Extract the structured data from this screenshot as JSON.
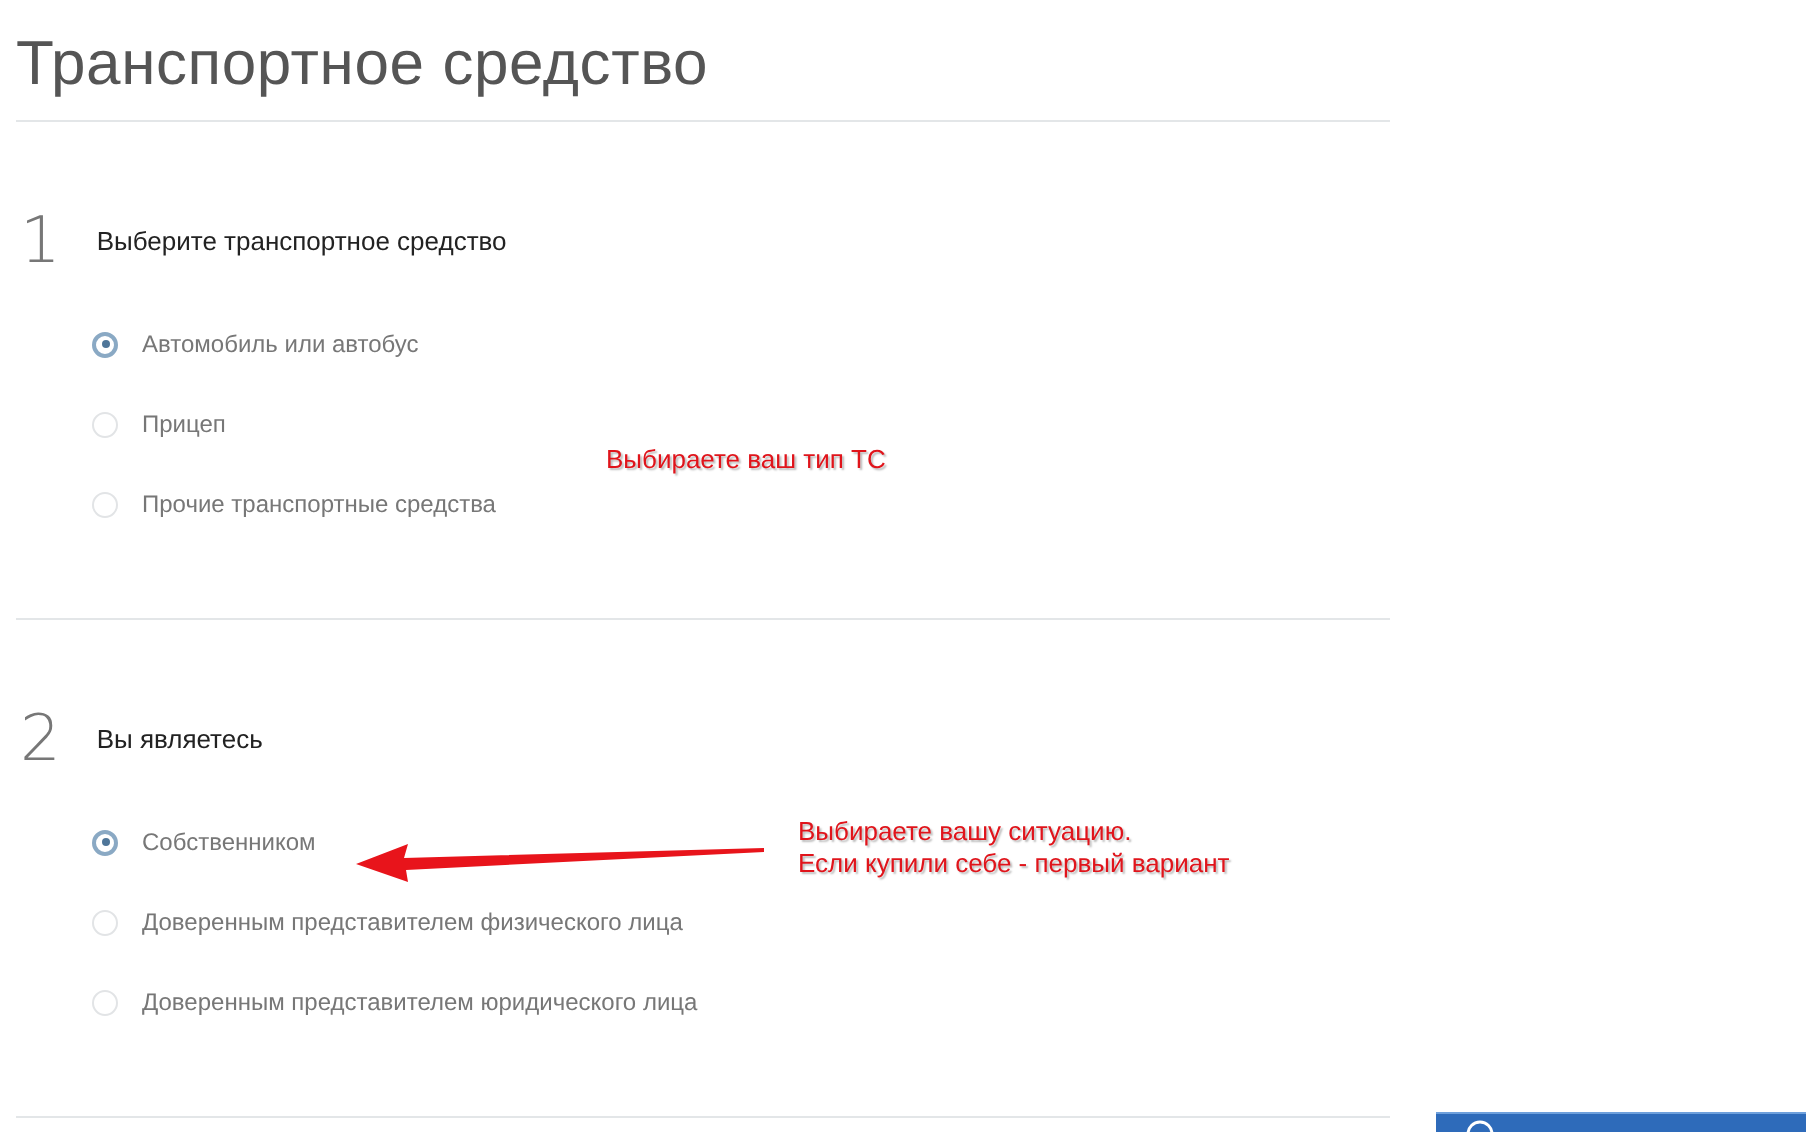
{
  "title": "Транспортное средство",
  "sections": [
    {
      "number": "1",
      "heading": "Выберите транспортное средство",
      "options": [
        {
          "label": "Автомобиль или автобус",
          "selected": true
        },
        {
          "label": "Прицеп",
          "selected": false
        },
        {
          "label": "Прочие транспортные средства",
          "selected": false
        }
      ]
    },
    {
      "number": "2",
      "heading": "Вы являетесь",
      "options": [
        {
          "label": "Собственником",
          "selected": true
        },
        {
          "label": "Доверенным представителем физического лица",
          "selected": false
        },
        {
          "label": "Доверенным представителем юридического лица",
          "selected": false
        }
      ]
    }
  ],
  "annotations": [
    {
      "kind": "note",
      "lines": [
        "Выбираете ваш тип ТС"
      ]
    },
    {
      "kind": "note",
      "lines": [
        "Выбираете вашу ситуацию.",
        "Если купили себе - первый вариант"
      ]
    },
    {
      "kind": "arrow"
    }
  ]
}
